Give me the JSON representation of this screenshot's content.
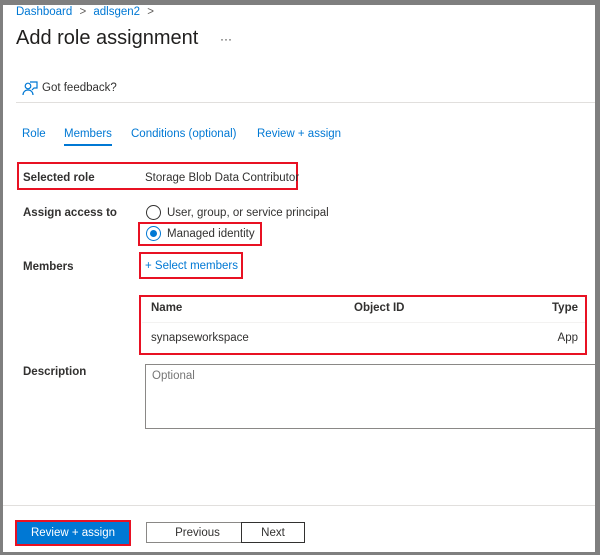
{
  "breadcrumb": {
    "items": [
      "Dashboard",
      "adlsgen2"
    ],
    "separator": ">"
  },
  "header": {
    "title": "Add role assignment",
    "more": "···"
  },
  "feedback": {
    "label": "Got feedback?",
    "icon": "feedback-person-icon"
  },
  "tabs": [
    {
      "label": "Role"
    },
    {
      "label": "Members",
      "active": true
    },
    {
      "label": "Conditions (optional)"
    },
    {
      "label": "Review + assign"
    }
  ],
  "form": {
    "selected_role_label": "Selected role",
    "selected_role_value": "Storage Blob Data Contributor",
    "assign_access_label": "Assign access to",
    "options": [
      {
        "label": "User, group, or service principal",
        "checked": false
      },
      {
        "label": "Managed identity",
        "checked": true
      }
    ],
    "members_label": "Members",
    "select_members": "+ Select members",
    "table": {
      "headers": [
        "Name",
        "Object ID",
        "Type"
      ],
      "rows": [
        [
          "synapseworkspace",
          "",
          "App"
        ]
      ]
    },
    "description_label": "Description",
    "description_placeholder": "Optional"
  },
  "footer": {
    "review_assign": "Review + assign",
    "previous": "Previous",
    "next": "Next"
  },
  "colors": {
    "accent": "#0078d4",
    "highlight": "#e81123"
  }
}
